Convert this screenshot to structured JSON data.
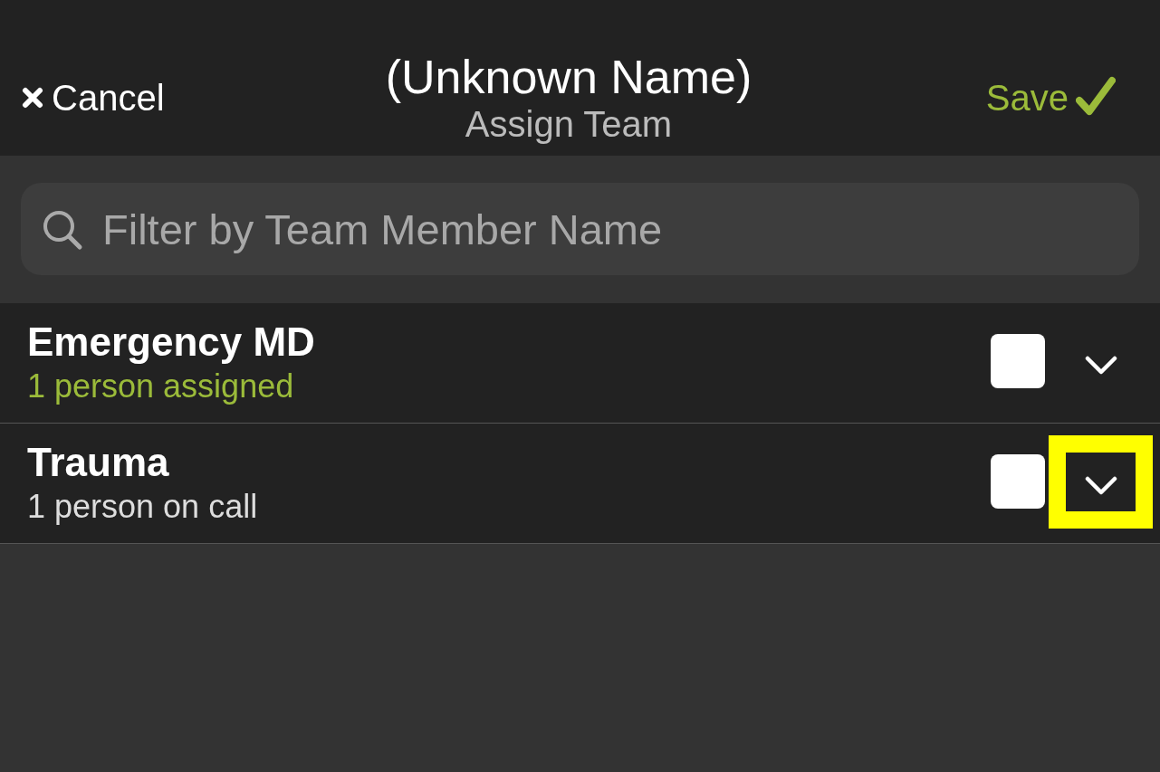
{
  "header": {
    "cancel": "Cancel",
    "title": "(Unknown Name)",
    "subtitle": "Assign Team",
    "save": "Save"
  },
  "search": {
    "placeholder": "Filter by Team Member Name"
  },
  "teams": [
    {
      "name": "Emergency MD",
      "status": "1 person assigned",
      "color": "#9bbb3a",
      "checked": false,
      "expanded": false,
      "highlighted": false
    },
    {
      "name": "Trauma",
      "status": "1 person on call",
      "color": "#dddddd",
      "checked": false,
      "expanded": false,
      "highlighted": true
    }
  ]
}
